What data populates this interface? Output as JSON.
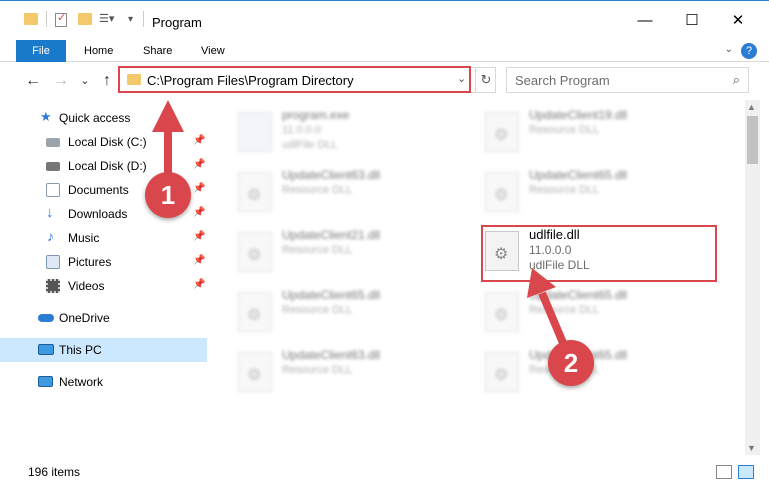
{
  "window": {
    "title": "Program",
    "controls": {
      "minimize": "—",
      "maximize": "☐",
      "close": "✕"
    }
  },
  "ribbon": {
    "file": "File",
    "tabs": [
      "Home",
      "Share",
      "View"
    ],
    "help": "?",
    "expand": "⌄"
  },
  "nav": {
    "back": "←",
    "forward": "→",
    "recent": "⌄",
    "up": "↑",
    "address": "C:\\Program Files\\Program Directory",
    "address_dropdown": "⌄",
    "refresh": "↻",
    "search_placeholder": "Search Program",
    "search_icon": "⌕"
  },
  "sidebar": {
    "quick_access": "Quick access",
    "pinned": [
      {
        "label": "Local Disk (C:)",
        "icon": "drive-icon"
      },
      {
        "label": "Local Disk (D:)",
        "icon": "drive-icon"
      },
      {
        "label": "Documents",
        "icon": "documents-icon"
      },
      {
        "label": "Downloads",
        "icon": "downloads-icon"
      },
      {
        "label": "Music",
        "icon": "music-icon"
      },
      {
        "label": "Pictures",
        "icon": "pictures-icon"
      },
      {
        "label": "Videos",
        "icon": "videos-icon"
      }
    ],
    "onedrive": "OneDrive",
    "this_pc": "This PC",
    "network": "Network"
  },
  "files": {
    "left": [
      {
        "name": "program.exe",
        "line2": "11.0.0.0",
        "line3": "udlFile DLL"
      },
      {
        "name": "UpdateClient63.dll",
        "line2": "Resource DLL",
        "line3": ""
      },
      {
        "name": "UpdateClient21.dll",
        "line2": "Resource DLL",
        "line3": ""
      },
      {
        "name": "UpdateClient65.dll",
        "line2": "Resource DLL",
        "line3": ""
      },
      {
        "name": "UpdateClient63.dll",
        "line2": "Resource DLL",
        "line3": ""
      }
    ],
    "right": [
      {
        "name": "UpdateClient19.dll",
        "line2": "Resource DLL",
        "line3": ""
      },
      {
        "name": "UpdateClient65.dll",
        "line2": "Resource DLL",
        "line3": ""
      },
      {
        "name": "udlfile.dll",
        "line2": "11.0.0.0",
        "line3": "udlFile DLL"
      },
      {
        "name": "UpdateClient65.dll",
        "line2": "Resource DLL",
        "line3": ""
      },
      {
        "name": "UpdateClient65.dll",
        "line2": "Resource DLL",
        "line3": ""
      }
    ]
  },
  "status": {
    "item_count": "196 items"
  },
  "callouts": {
    "one": "1",
    "two": "2"
  },
  "colors": {
    "accent": "#1979ca",
    "highlight": "#d9464b",
    "selection": "#cce8ff"
  }
}
